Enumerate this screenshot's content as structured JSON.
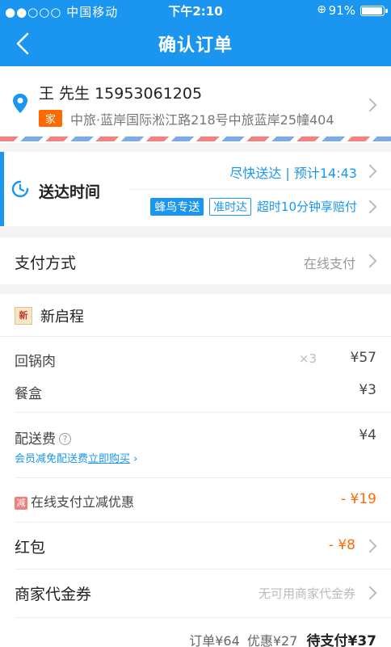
{
  "status": {
    "signal": "●●○○○ 中国移动",
    "time": "下午2:10",
    "battery": "91%"
  },
  "nav": {
    "title": "确认订单"
  },
  "address": {
    "contact": "王 先生 15953061205",
    "tag": "家",
    "detail": "中旅·蓝岸国际淞江路218号中旅蓝岸25幢404"
  },
  "delivery": {
    "label": "送达时间",
    "speed": "尽快送达 | 预计14:43",
    "badge_fill": "蜂鸟专送",
    "badge_out": "准时达",
    "guarantee": "超时10分钟享赔付"
  },
  "payment": {
    "label": "支付方式",
    "value": "在线支付"
  },
  "order": {
    "shop_name": "新启程",
    "items": [
      {
        "name": "回锅肉",
        "qty": "×3",
        "price": "¥57"
      },
      {
        "name": "餐盒",
        "qty": "",
        "price": "¥3"
      }
    ],
    "delivery_fee": {
      "label": "配送费",
      "price": "¥4"
    },
    "vip_note": "会员减免配送费",
    "vip_link": "立即购买",
    "online_promo": {
      "icon": "减",
      "label": "在线支付立减优惠",
      "value": "- ¥19"
    },
    "red_packet": {
      "label": "红包",
      "value": "- ¥8"
    },
    "voucher": {
      "label": "商家代金券",
      "value": "无可用商家代金券"
    },
    "summary": {
      "total": "订单¥64",
      "discount": "优惠¥27",
      "due": "待支付¥37"
    }
  }
}
